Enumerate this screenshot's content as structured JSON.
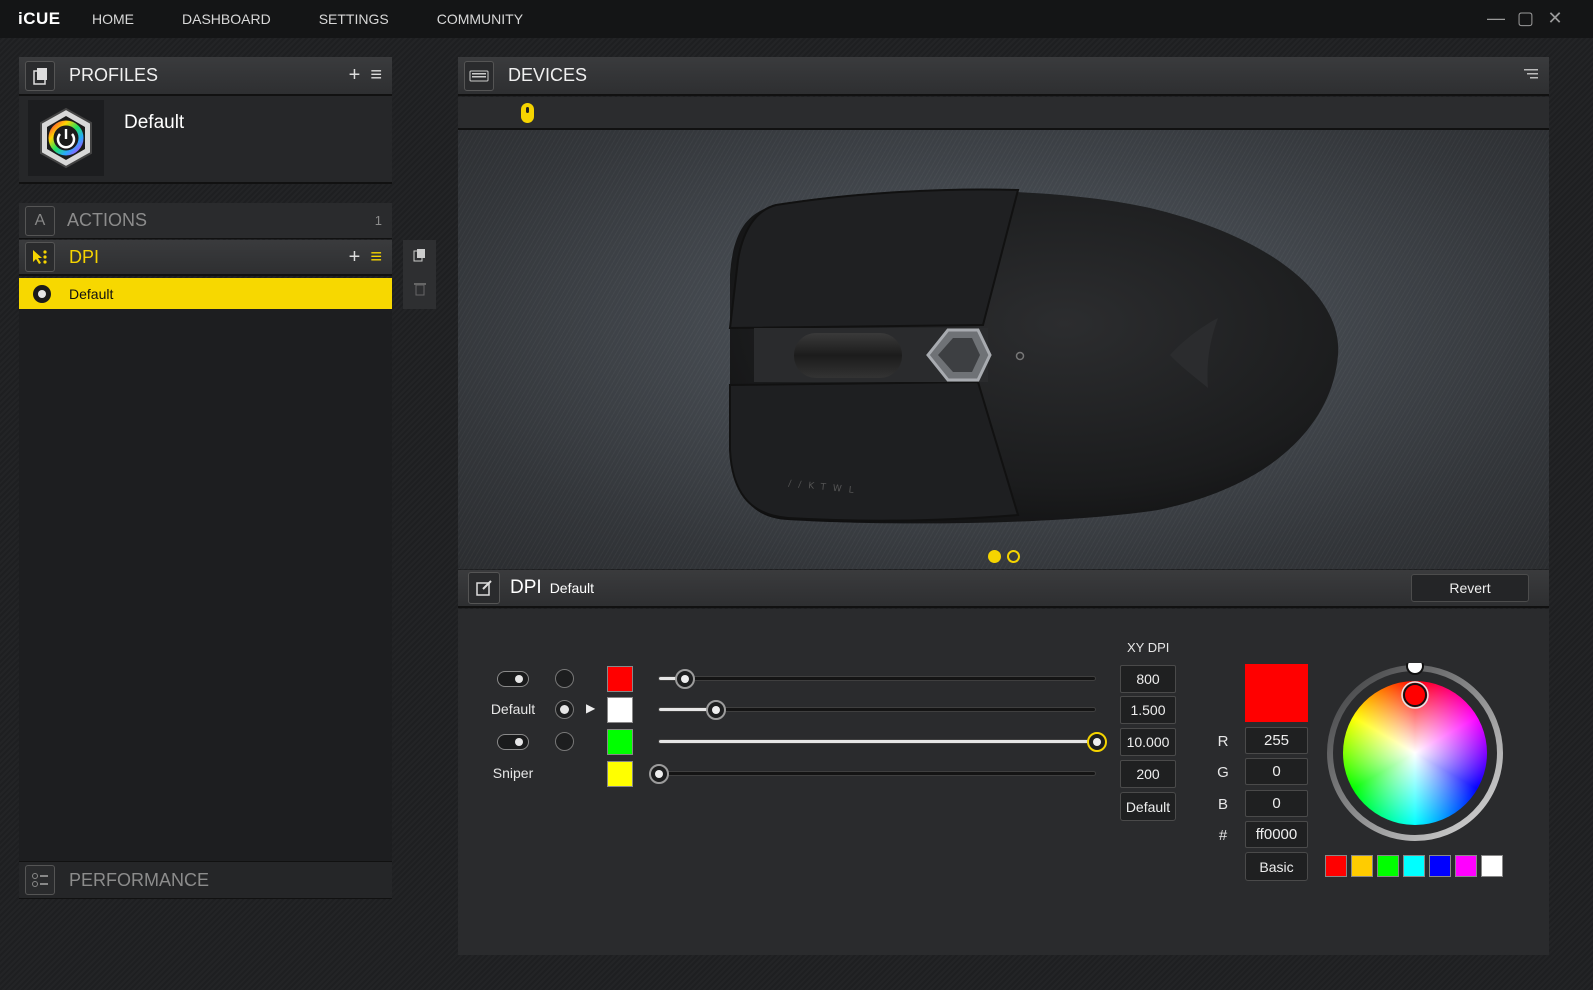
{
  "app": {
    "logo": "iCUE",
    "nav": [
      "HOME",
      "DASHBOARD",
      "SETTINGS",
      "COMMUNITY"
    ]
  },
  "profiles": {
    "title": "PROFILES",
    "current": "Default"
  },
  "actions": {
    "label": "ACTIONS",
    "count": "1"
  },
  "dpi_panel_left": {
    "title": "DPI",
    "items": [
      "Default"
    ]
  },
  "performance": {
    "label": "PERFORMANCE"
  },
  "devices": {
    "title": "DEVICES",
    "pages": 2,
    "active_page": 1
  },
  "dpi_settings": {
    "title": "DPI",
    "subtitle": "Default",
    "revert_label": "Revert",
    "xy_title": "XY DPI",
    "default_button": "Default",
    "stages": [
      {
        "label": "",
        "enabled": true,
        "selected": false,
        "color": "#ff0000",
        "fraction": 0.06,
        "value": "800"
      },
      {
        "label": "Default",
        "enabled": null,
        "selected": true,
        "color": "#ffffff",
        "fraction": 0.13,
        "value": "1.500"
      },
      {
        "label": "",
        "enabled": true,
        "selected": false,
        "color": "#00ff00",
        "fraction": 1.0,
        "value": "10.000"
      },
      {
        "label": "Sniper",
        "enabled": null,
        "selected": false,
        "color": "#ffff00",
        "fraction": 0.0,
        "value": "200"
      }
    ]
  },
  "color_picker": {
    "preview": "#ff0000",
    "r": "255",
    "g": "0",
    "b": "0",
    "hex": "ff0000",
    "labels": {
      "r": "R",
      "g": "G",
      "b": "B",
      "hex": "#"
    },
    "basic_label": "Basic",
    "presets": [
      "#ff0000",
      "#ffcc00",
      "#00ff00",
      "#00ffff",
      "#0000ff",
      "#ff00ff",
      "#ffffff"
    ]
  }
}
